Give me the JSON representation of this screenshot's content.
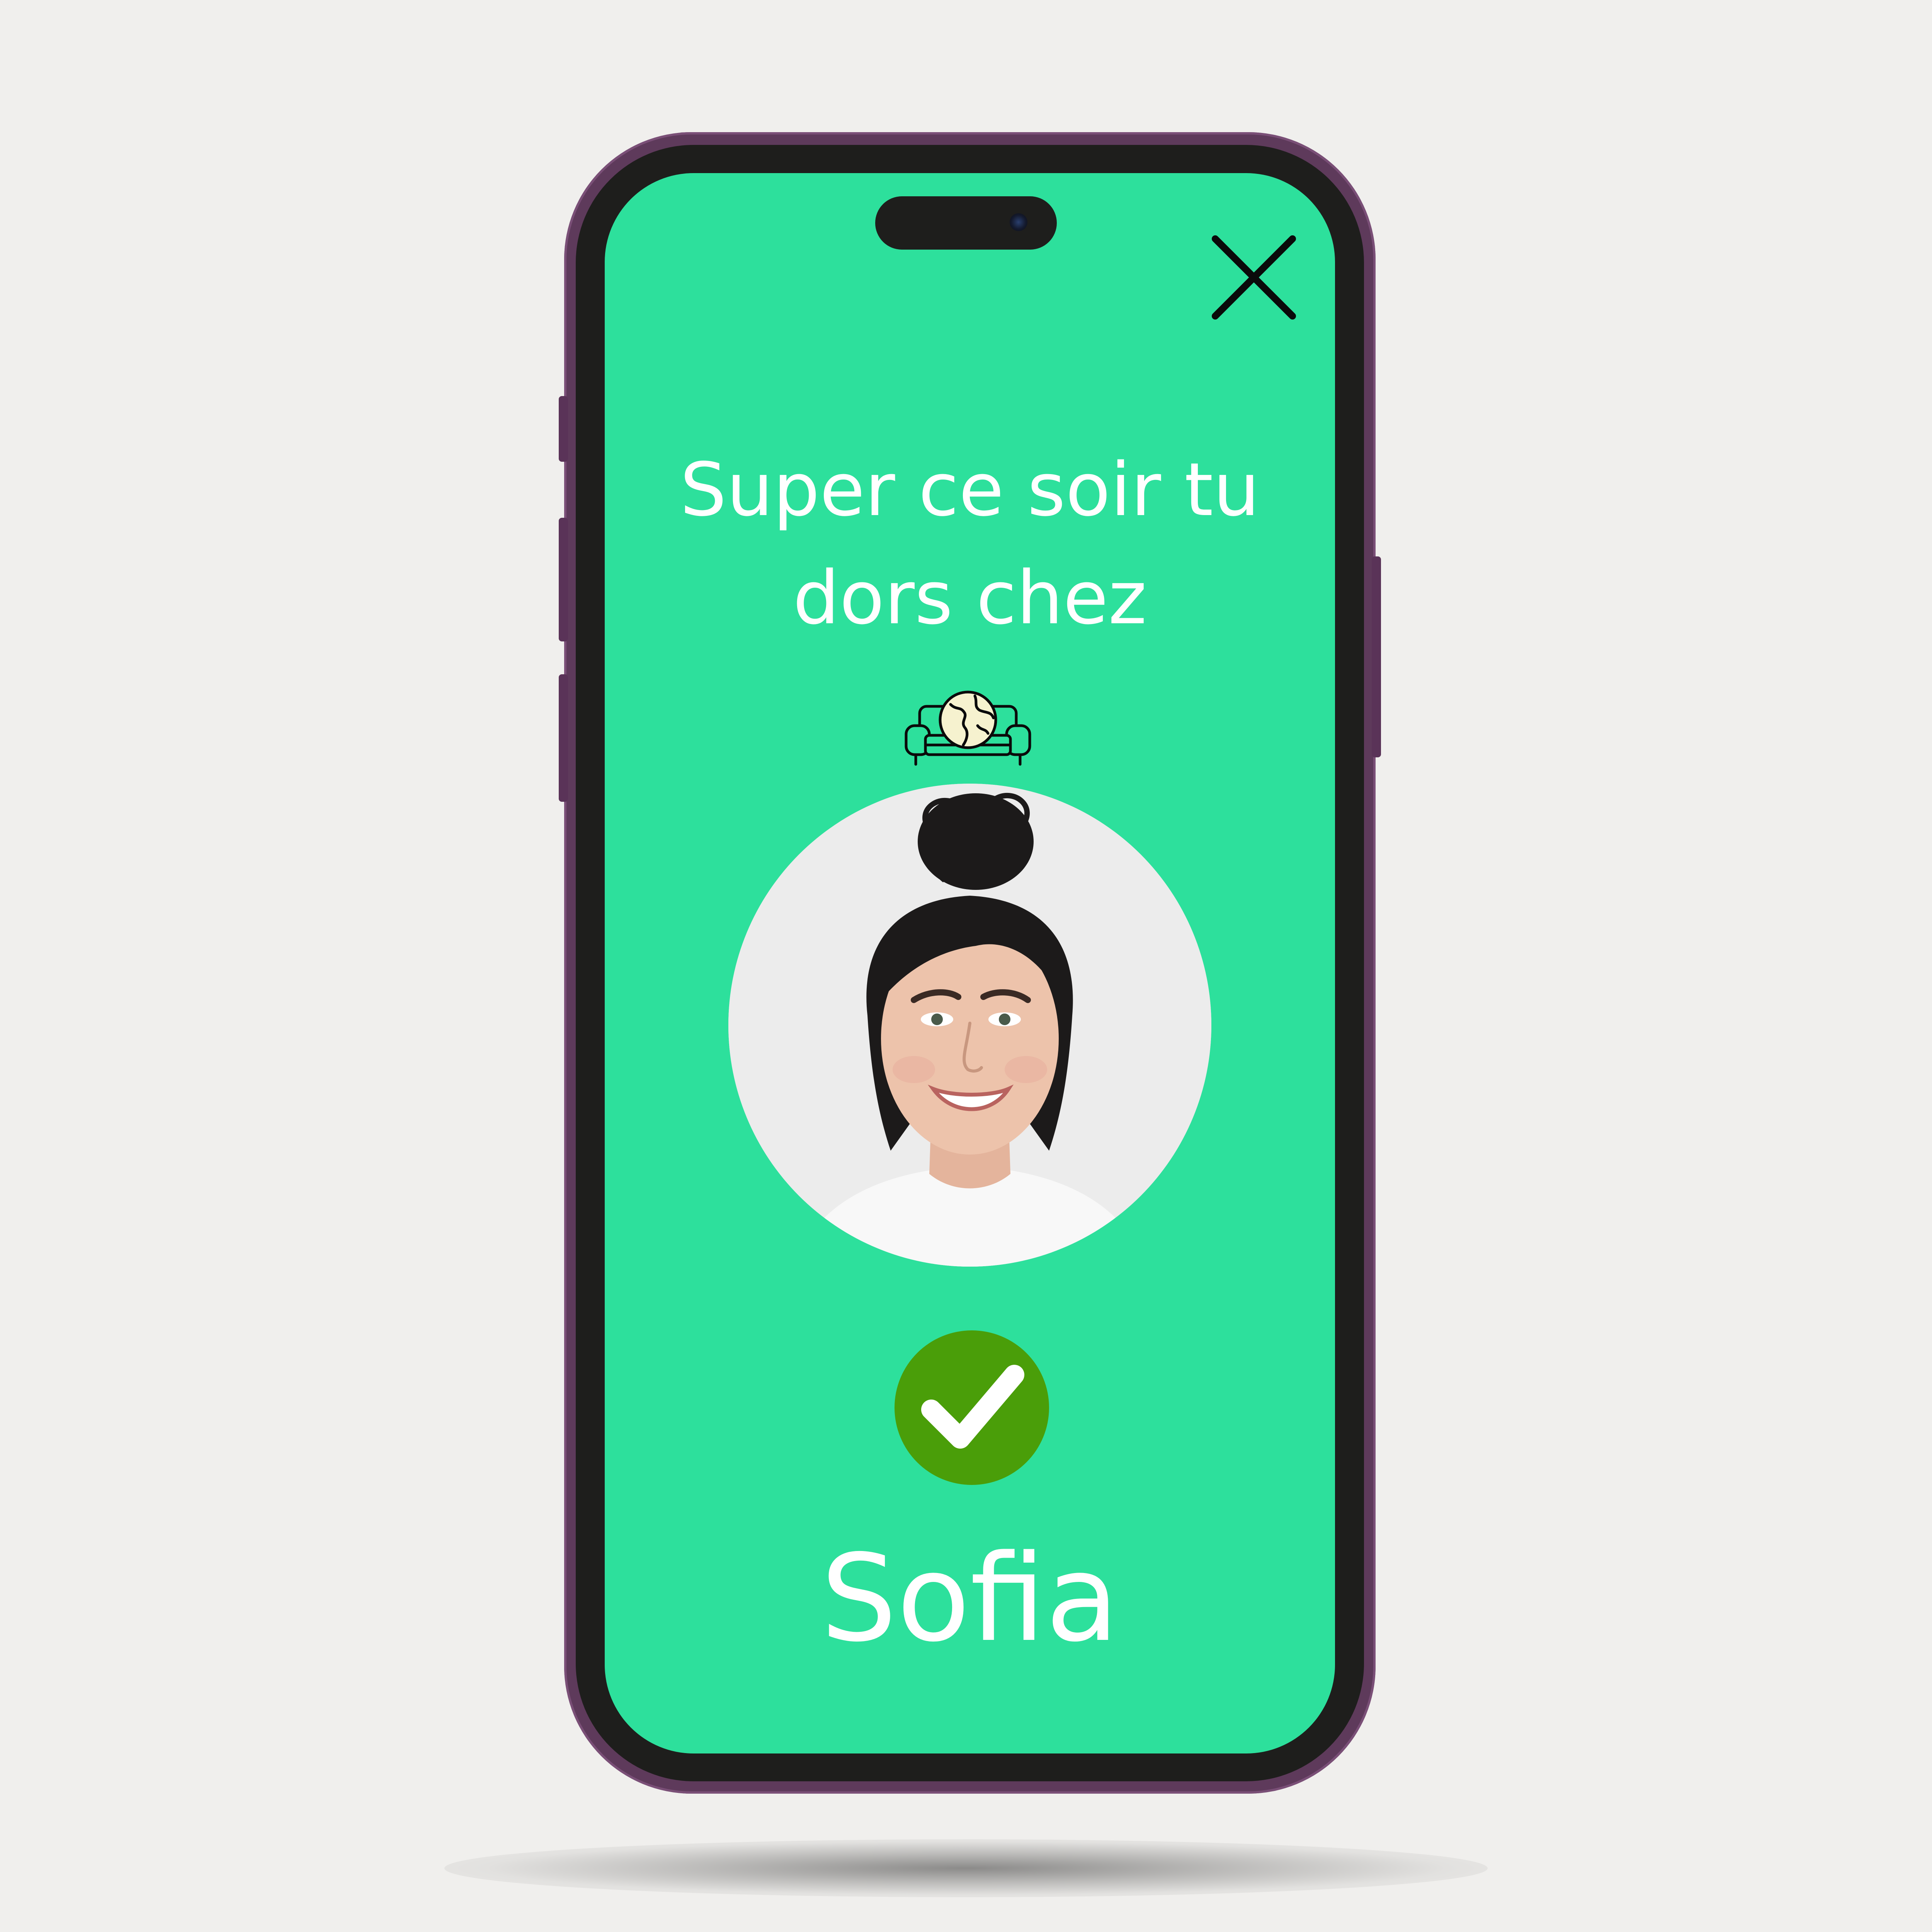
{
  "screen": {
    "headline": "Super ce soir tu dors chez",
    "host_name": "Sofia"
  },
  "icons": {
    "close": "close-icon",
    "sofa_globe": "sofa-globe-icon",
    "confirm": "checkmark-icon",
    "avatar": "host-avatar"
  },
  "colors": {
    "screen_background": "#2de09c",
    "text": "#ffffff",
    "confirm_green": "#4a9e09",
    "phone_frame": "#5e3a5b",
    "phone_bezel": "#1e1e1c",
    "page_background": "#f0efed"
  }
}
